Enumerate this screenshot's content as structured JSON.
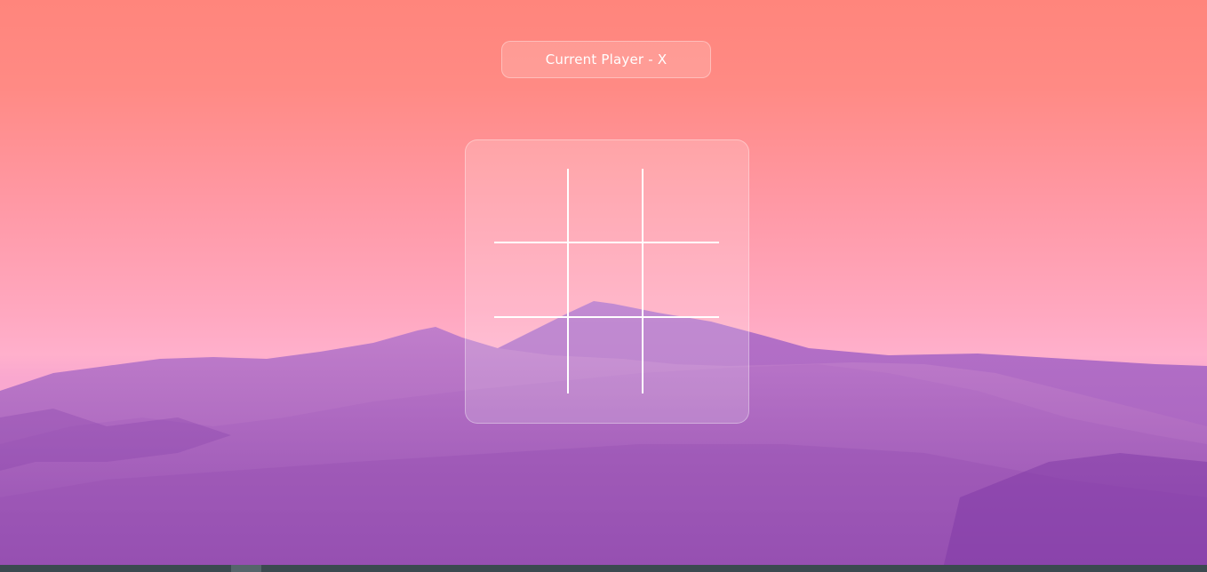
{
  "status": {
    "text": "Current Player - X"
  },
  "board": {
    "cells": [
      "",
      "",
      "",
      "",
      "",
      "",
      "",
      "",
      ""
    ]
  },
  "colors": {
    "sky_top": "#ff857c",
    "sky_bottom": "#ffb0cc",
    "mountain": "#9a4fb3",
    "grid_line": "#ffffff"
  }
}
